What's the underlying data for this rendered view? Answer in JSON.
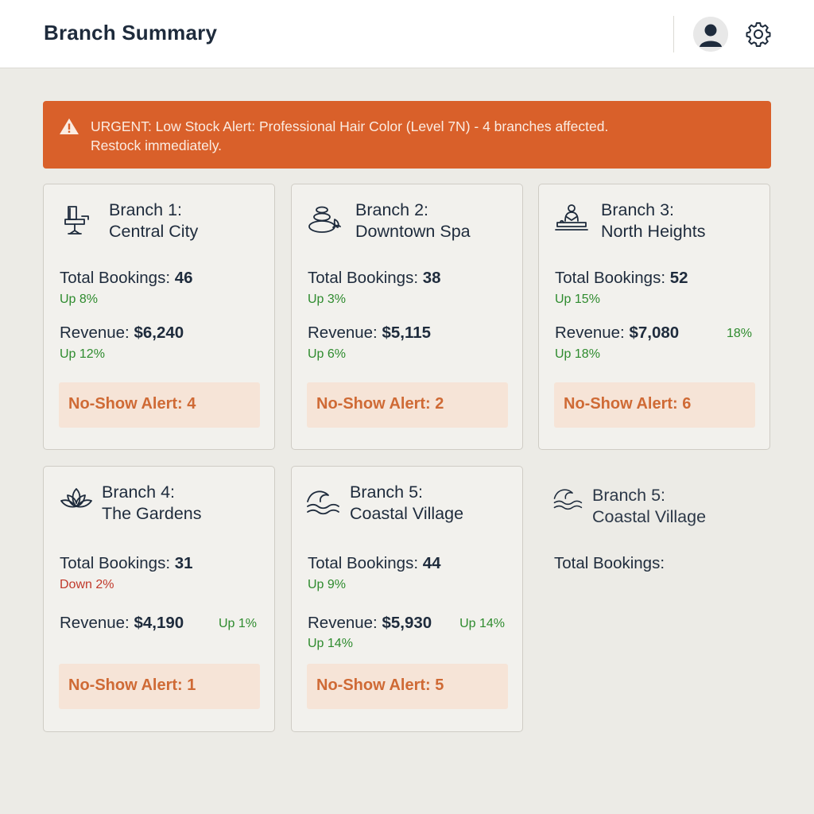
{
  "header": {
    "title": "Branch Summary",
    "avatar_icon": "user-avatar-icon",
    "settings_icon": "gear-icon"
  },
  "alert_banner": {
    "icon": "warning-icon",
    "line1": "URGENT: Low Stock Alert: Professional Hair Color (Level 7N) - 4 branches affected.",
    "line2": "Restock immediately.",
    "color": "#d9602a"
  },
  "branches": [
    {
      "title_line1": "Branch 1:",
      "title_line2": "Central City",
      "icon": "salon-chair-icon",
      "bookings_label": "Total Bookings:",
      "bookings_value": "46",
      "bookings_trend": "Up 8%",
      "revenue_label": "Revenue:",
      "revenue_value": "$6,240",
      "revenue_trend": "Up 12%",
      "noshow": "No-Show Alert: 4"
    },
    {
      "title_line1": "Branch 2:",
      "title_line2": "Downtown Spa",
      "icon": "spa-stones-icon",
      "bookings_label": "Total Bookings:",
      "bookings_value": "38",
      "bookings_trend": "Up 3%",
      "revenue_label": "Revenue:",
      "revenue_value": "$5,115",
      "revenue_trend": "Up 6%",
      "noshow": "No-Show Alert: 2"
    },
    {
      "title_line1": "Branch 3:",
      "title_line2": "North Heights",
      "icon": "massage-icon",
      "bookings_label": "Total Bookings:",
      "bookings_value": "52",
      "bookings_trend": "Up 15%",
      "revenue_label": "Revenue:",
      "revenue_value": "$7,080",
      "revenue_side": "18%",
      "revenue_trend": "Up 18%",
      "noshow": "No-Show Alert: 6"
    },
    {
      "title_line1": "Branch 4:",
      "title_line2": "The Gardens",
      "icon": "lotus-icon",
      "bookings_label": "Total Bookings:",
      "bookings_value": "31",
      "bookings_trend": "Down 2%",
      "revenue_label": "Revenue:",
      "revenue_value": "$4,190",
      "revenue_side": "Up 1%",
      "noshow": "No-Show Alert: 1"
    },
    {
      "title_line1": "Branch 5:",
      "title_line2": "Coastal Village",
      "icon": "waves-icon",
      "bookings_label": "Total Bookings:",
      "bookings_value": "44",
      "bookings_trend": "Up 9%",
      "revenue_label": "Revenue:",
      "revenue_value": "$5,930",
      "revenue_side": "Up 14%",
      "revenue_trend": "Up 14%",
      "noshow": "No-Show Alert: 5"
    }
  ],
  "ghost_card": {
    "title_line1": "Branch 5:",
    "title_line2": "Coastal Village",
    "icon": "waves-icon",
    "bookings_label": "Total Bookings:"
  },
  "colors": {
    "accent": "#d9602a",
    "up": "#2e8b2e",
    "down": "#c0392b",
    "alert_text": "#cf6a35",
    "alert_bg": "#f6e4d7"
  }
}
